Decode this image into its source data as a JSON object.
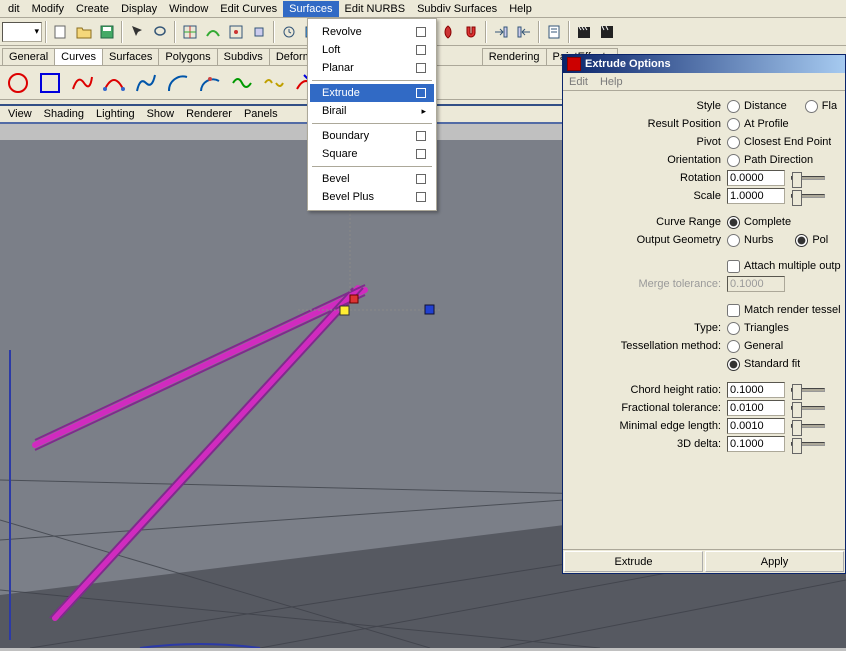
{
  "menubar": [
    "dit",
    "Modify",
    "Create",
    "Display",
    "Window",
    "Edit Curves",
    "Surfaces",
    "Edit NURBS",
    "Subdiv Surfaces",
    "Help"
  ],
  "menubar_active_index": 6,
  "shelf_tabs": [
    "General",
    "Curves",
    "Surfaces",
    "Polygons",
    "Subdivs",
    "Deformation",
    "Rendering",
    "PaintEffects"
  ],
  "shelf_active_index": 1,
  "panel_menu": [
    "View",
    "Shading",
    "Lighting",
    "Show",
    "Renderer",
    "Panels"
  ],
  "dropdown": {
    "groups": [
      [
        "Revolve",
        "Loft",
        "Planar"
      ],
      [
        "Extrude",
        "Birail"
      ],
      [
        "Boundary",
        "Square"
      ],
      [
        "Bevel",
        "Bevel Plus"
      ]
    ],
    "selected": "Extrude",
    "submenu_item": "Birail"
  },
  "options_window": {
    "title": "Extrude Options",
    "menu": [
      "Edit",
      "Help"
    ],
    "labels": {
      "style": "Style",
      "result_position": "Result Position",
      "pivot": "Pivot",
      "orientation": "Orientation",
      "rotation": "Rotation",
      "scale": "Scale",
      "curve_range": "Curve Range",
      "output_geometry": "Output Geometry",
      "merge_tolerance": "Merge tolerance:",
      "type": "Type:",
      "tessellation_method": "Tessellation method:",
      "chord_height_ratio": "Chord height ratio:",
      "fractional_tolerance": "Fractional tolerance:",
      "minimal_edge_length": "Minimal edge length:",
      "delta_3d": "3D delta:"
    },
    "radios": {
      "style": [
        "Distance",
        "Fla"
      ],
      "result_position": "At Profile",
      "pivot": "Closest End Point",
      "orientation": "Path Direction",
      "curve_range": "Complete",
      "output_geometry": [
        "Nurbs",
        "Pol"
      ],
      "type": "Triangles",
      "tess": [
        "General",
        "Standard fit"
      ]
    },
    "checkboxes": {
      "attach": "Attach multiple outp",
      "match_render": "Match render tessel"
    },
    "values": {
      "rotation": "0.0000",
      "scale": "1.0000",
      "merge_tolerance": "0.1000",
      "chord_height_ratio": "0.1000",
      "fractional_tolerance": "0.0100",
      "minimal_edge_length": "0.0010",
      "delta_3d": "0.1000"
    },
    "buttons": {
      "extrude": "Extrude",
      "apply": "Apply"
    }
  }
}
